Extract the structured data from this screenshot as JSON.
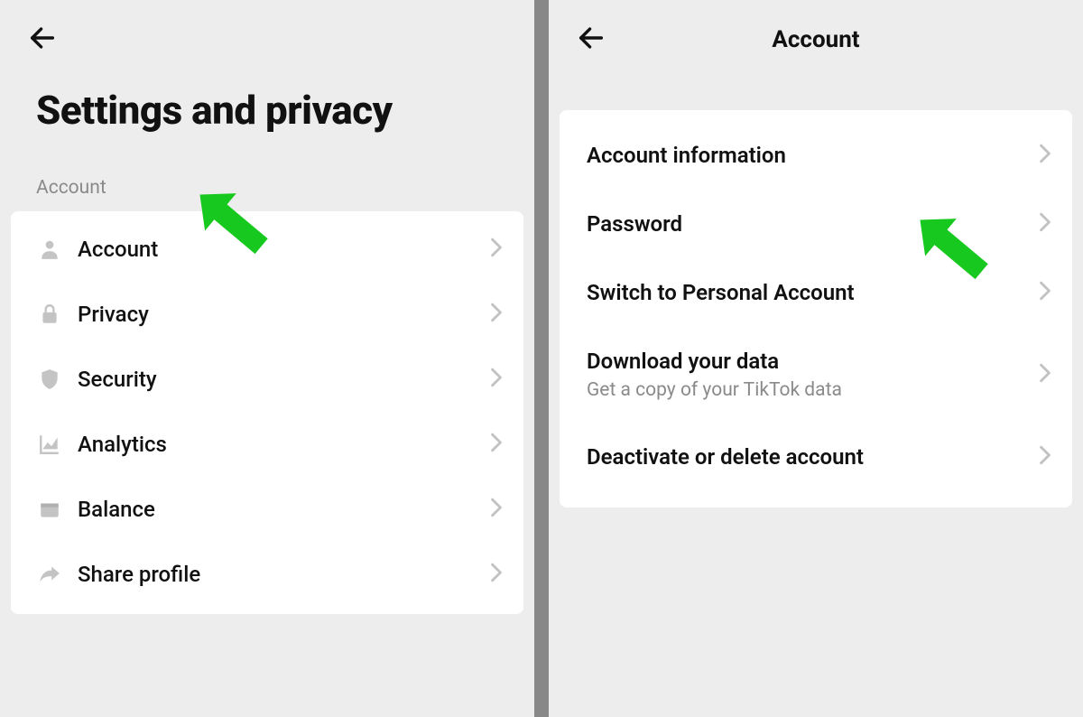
{
  "left": {
    "title": "Settings and privacy",
    "section_label": "Account",
    "items": [
      {
        "label": "Account"
      },
      {
        "label": "Privacy"
      },
      {
        "label": "Security"
      },
      {
        "label": "Analytics"
      },
      {
        "label": "Balance"
      },
      {
        "label": "Share profile"
      }
    ]
  },
  "right": {
    "title": "Account",
    "items": [
      {
        "label": "Account information"
      },
      {
        "label": "Password"
      },
      {
        "label": "Switch to Personal Account"
      },
      {
        "label": "Download your data",
        "sub": "Get a copy of your TikTok data"
      },
      {
        "label": "Deactivate or delete account"
      }
    ]
  }
}
